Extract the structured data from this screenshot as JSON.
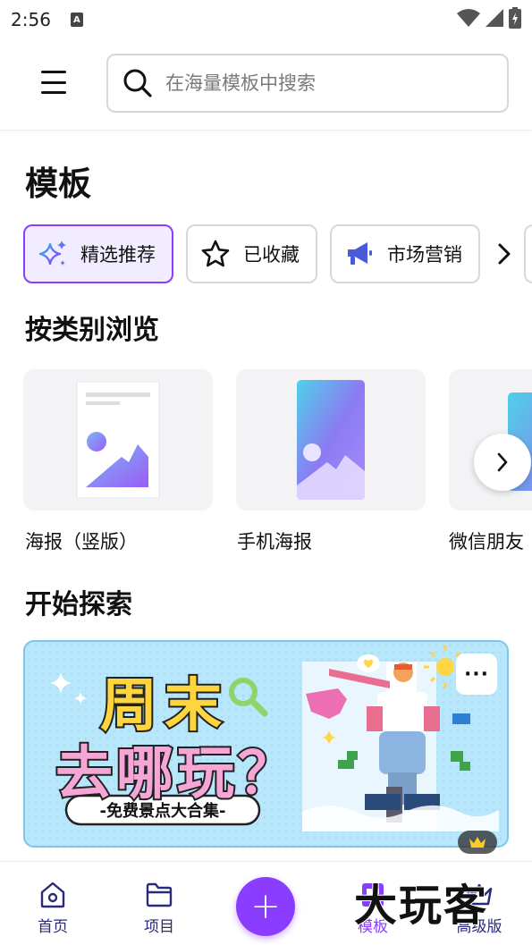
{
  "status_bar": {
    "time": "2:56",
    "notification_icon": "A"
  },
  "header": {
    "search_placeholder": "在海量模板中搜索"
  },
  "page_title": "模板",
  "chips": [
    {
      "label": "精选推荐",
      "icon": "sparkle-icon",
      "active": true
    },
    {
      "label": "已收藏",
      "icon": "star-icon",
      "active": false
    },
    {
      "label": "市场营销",
      "icon": "megaphone-icon",
      "active": false
    }
  ],
  "browse_section": {
    "title": "按类别浏览",
    "categories": [
      {
        "label": "海报（竖版）",
        "icon": "poster-icon"
      },
      {
        "label": "手机海报",
        "icon": "phone-poster-icon"
      },
      {
        "label": "微信朋友",
        "icon": "wechat-moments-icon"
      }
    ]
  },
  "explore_section": {
    "title": "开始探索",
    "banner": {
      "title_line1": "周末",
      "title_line2": "去哪玩？",
      "subtitle": "-免费景点大合集-",
      "more_label": "···"
    }
  },
  "bottom_nav": {
    "items": [
      {
        "label": "首页",
        "icon": "home-icon",
        "active": false
      },
      {
        "label": "项目",
        "icon": "folder-icon",
        "active": false
      },
      {
        "label": "模板",
        "icon": "template-icon",
        "active": true
      },
      {
        "label": "高级版",
        "icon": "crown-icon",
        "active": false
      }
    ],
    "fab_label": "+"
  },
  "watermark": "大玩客",
  "colors": {
    "accent": "#8b3dff",
    "chip_active_bg": "#f1ecff",
    "card_bg": "#f3f3f5",
    "banner_bg": "#b8e6fa"
  }
}
